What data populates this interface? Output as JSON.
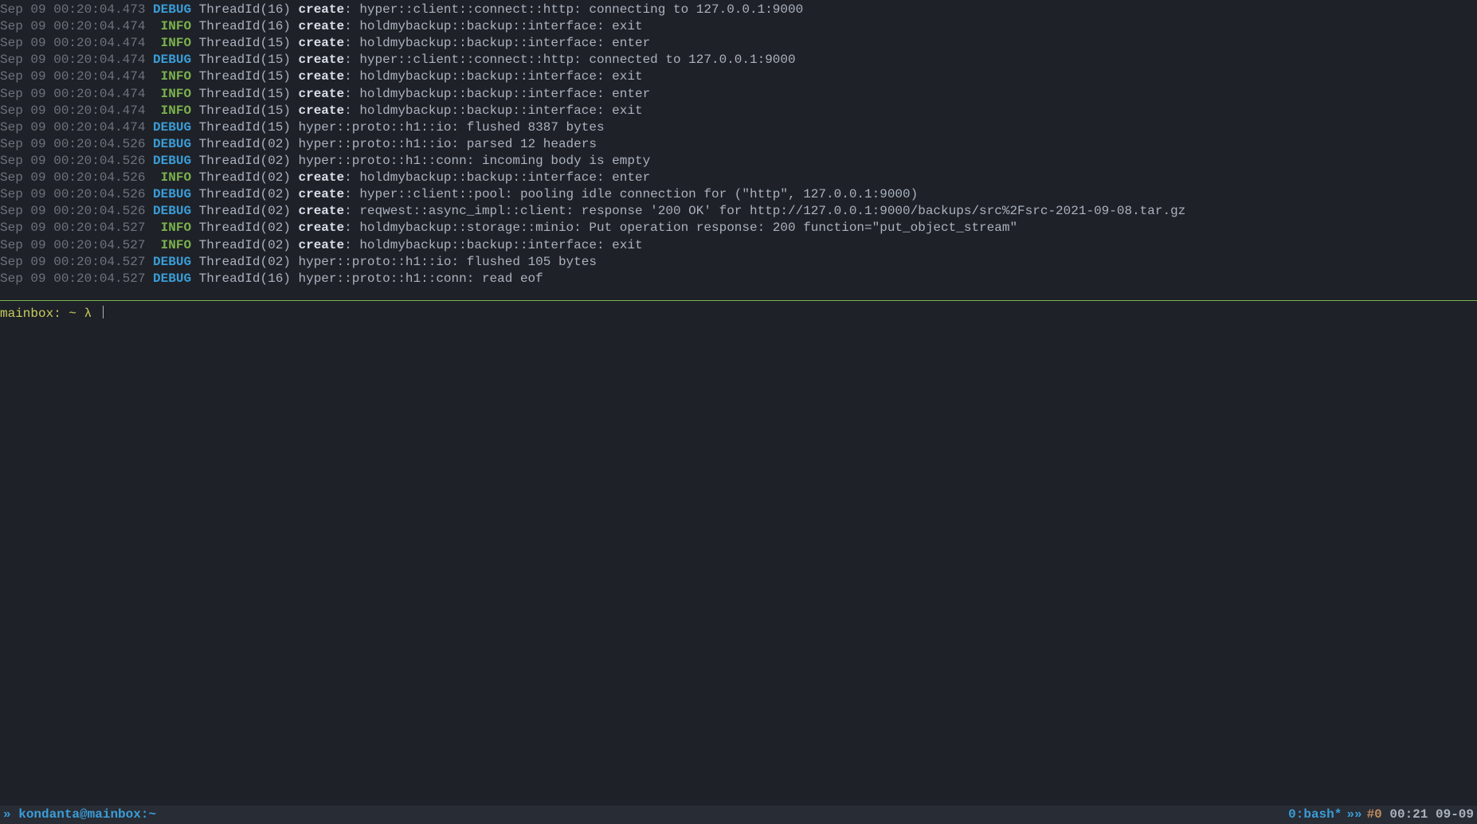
{
  "log_lines": [
    {
      "ts": "Sep 09 00:20:04.473",
      "level": "DEBUG",
      "thread": "ThreadId(16)",
      "create": true,
      "msg": "hyper::client::connect::http: connecting to 127.0.0.1:9000"
    },
    {
      "ts": "Sep 09 00:20:04.474",
      "level": "INFO",
      "thread": "ThreadId(16)",
      "create": true,
      "msg": "holdmybackup::backup::interface: exit"
    },
    {
      "ts": "Sep 09 00:20:04.474",
      "level": "INFO",
      "thread": "ThreadId(15)",
      "create": true,
      "msg": "holdmybackup::backup::interface: enter"
    },
    {
      "ts": "Sep 09 00:20:04.474",
      "level": "DEBUG",
      "thread": "ThreadId(15)",
      "create": true,
      "msg": "hyper::client::connect::http: connected to 127.0.0.1:9000"
    },
    {
      "ts": "Sep 09 00:20:04.474",
      "level": "INFO",
      "thread": "ThreadId(15)",
      "create": true,
      "msg": "holdmybackup::backup::interface: exit"
    },
    {
      "ts": "Sep 09 00:20:04.474",
      "level": "INFO",
      "thread": "ThreadId(15)",
      "create": true,
      "msg": "holdmybackup::backup::interface: enter"
    },
    {
      "ts": "Sep 09 00:20:04.474",
      "level": "INFO",
      "thread": "ThreadId(15)",
      "create": true,
      "msg": "holdmybackup::backup::interface: exit"
    },
    {
      "ts": "Sep 09 00:20:04.474",
      "level": "DEBUG",
      "thread": "ThreadId(15)",
      "create": false,
      "msg": "hyper::proto::h1::io: flushed 8387 bytes"
    },
    {
      "ts": "Sep 09 00:20:04.526",
      "level": "DEBUG",
      "thread": "ThreadId(02)",
      "create": false,
      "msg": "hyper::proto::h1::io: parsed 12 headers"
    },
    {
      "ts": "Sep 09 00:20:04.526",
      "level": "DEBUG",
      "thread": "ThreadId(02)",
      "create": false,
      "msg": "hyper::proto::h1::conn: incoming body is empty"
    },
    {
      "ts": "Sep 09 00:20:04.526",
      "level": "INFO",
      "thread": "ThreadId(02)",
      "create": true,
      "msg": "holdmybackup::backup::interface: enter"
    },
    {
      "ts": "Sep 09 00:20:04.526",
      "level": "DEBUG",
      "thread": "ThreadId(02)",
      "create": true,
      "msg": "hyper::client::pool: pooling idle connection for (\"http\", 127.0.0.1:9000)"
    },
    {
      "ts": "Sep 09 00:20:04.526",
      "level": "DEBUG",
      "thread": "ThreadId(02)",
      "create": true,
      "msg": "reqwest::async_impl::client: response '200 OK' for http://127.0.0.1:9000/backups/src%2Fsrc-2021-09-08.tar.gz"
    },
    {
      "ts": "Sep 09 00:20:04.527",
      "level": "INFO",
      "thread": "ThreadId(02)",
      "create": true,
      "msg": "holdmybackup::storage::minio: Put operation response: 200 function=\"put_object_stream\""
    },
    {
      "ts": "Sep 09 00:20:04.527",
      "level": "INFO",
      "thread": "ThreadId(02)",
      "create": true,
      "msg": "holdmybackup::backup::interface: exit"
    },
    {
      "ts": "Sep 09 00:20:04.527",
      "level": "DEBUG",
      "thread": "ThreadId(02)",
      "create": false,
      "msg": "hyper::proto::h1::io: flushed 105 bytes"
    },
    {
      "ts": "Sep 09 00:20:04.527",
      "level": "DEBUG",
      "thread": "ThreadId(16)",
      "create": false,
      "msg": "hyper::proto::h1::conn: read eof"
    }
  ],
  "prompt": {
    "host": "mainbox: ~",
    "lambda": "λ"
  },
  "status": {
    "left_chevron": "»",
    "user_host": "kondanta@mainbox:~",
    "right_tab": "0:bash*",
    "right_chevrons": "»»",
    "hash_pane": "#0",
    "clock": "00:21 09-09"
  }
}
